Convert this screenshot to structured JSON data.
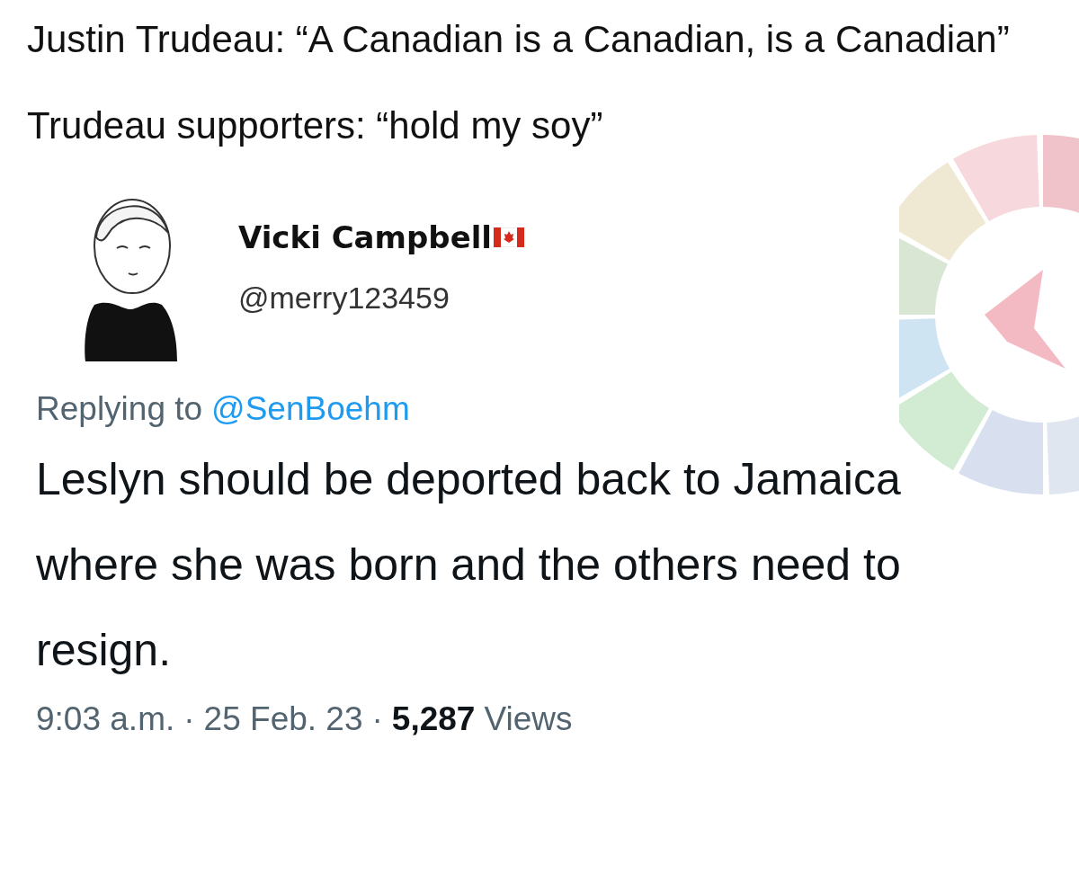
{
  "caption": [
    "Justin Trudeau: “A Canadian is a Canadian, is a Canadian”",
    "Trudeau supporters: “hold my soy”"
  ],
  "tweet": {
    "author_name": "Vicki Campbell",
    "handle": "@merry123459",
    "reply_label": "Replying to",
    "reply_to": "@SenBoehm",
    "text": "Leslyn should be deported back to Jamaica where she was born and the others need to resign.",
    "time": "9:03 a.m.",
    "separator_1": "·",
    "date": "25 Feb. 23",
    "separator_2": "·",
    "views_count": "5,287",
    "views_label": "Views"
  }
}
